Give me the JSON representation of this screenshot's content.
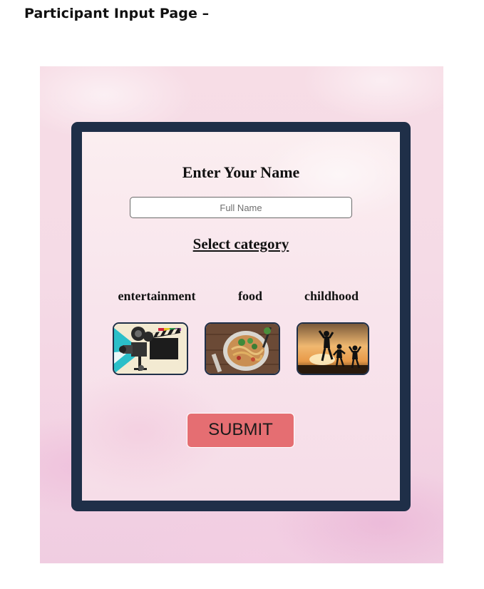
{
  "document": {
    "heading": "Participant Input Page –"
  },
  "form": {
    "name_title": "Enter Your Name",
    "name_placeholder": "Full Name",
    "name_value": "",
    "category_title": "Select category",
    "categories": [
      {
        "label": "entertainment",
        "image": "film-camera-clapperboard"
      },
      {
        "label": "food",
        "image": "bowl-of-noodles"
      },
      {
        "label": "childhood",
        "image": "children-silhouettes-sunset"
      }
    ],
    "submit_label": "SUBMIT"
  },
  "colors": {
    "frame": "#1f2f48",
    "submit_button": "#e56e72",
    "background": "#f5dbe6"
  }
}
